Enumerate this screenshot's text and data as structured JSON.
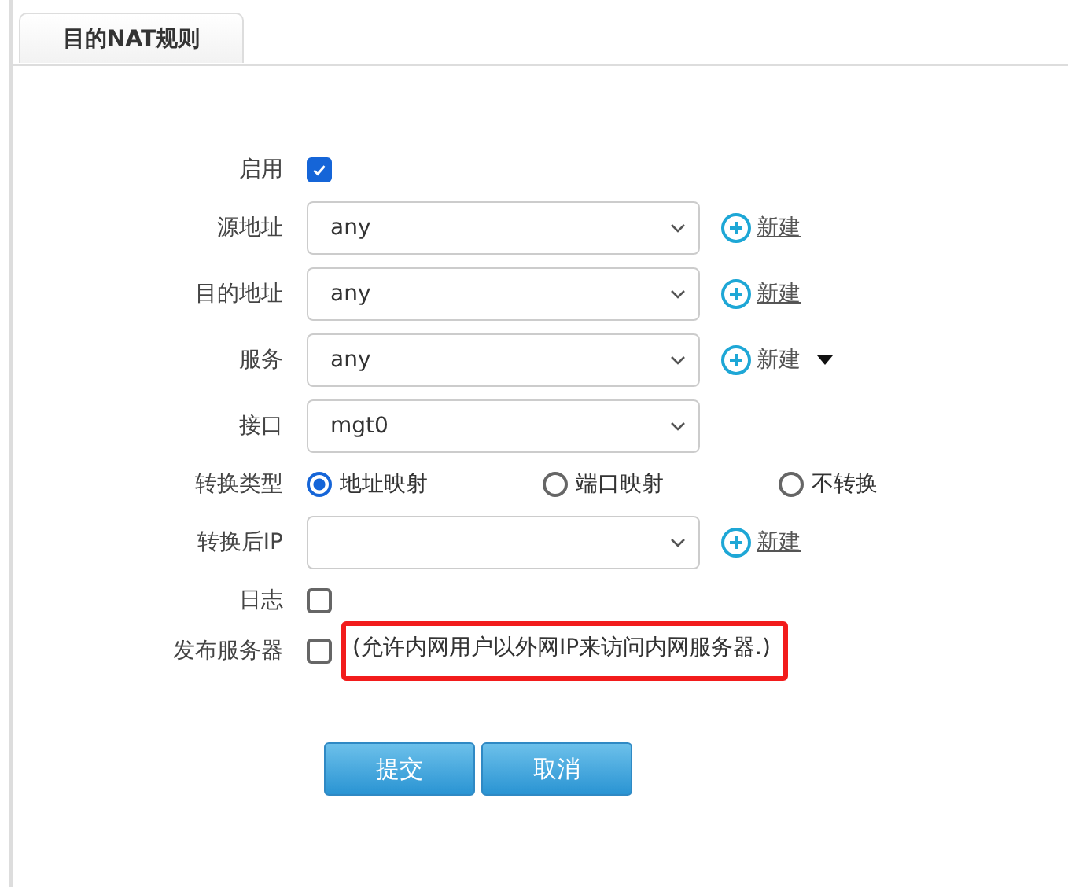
{
  "tabs": [
    {
      "label": "目的NAT规则",
      "selected": true
    }
  ],
  "form": [
    {
      "kind": "checkbox",
      "label": "启用",
      "checked": true
    },
    {
      "kind": "select",
      "label": "源地址",
      "value": "any",
      "new_link": {
        "label": "新建",
        "underlined": true,
        "dropdown": false
      }
    },
    {
      "kind": "select",
      "label": "目的地址",
      "value": "any",
      "new_link": {
        "label": "新建",
        "underlined": true,
        "dropdown": false
      }
    },
    {
      "kind": "select",
      "label": "服务",
      "value": "any",
      "new_link": {
        "label": "新建",
        "underlined": false,
        "dropdown": true
      }
    },
    {
      "kind": "select",
      "label": "接口",
      "value": "mgt0"
    },
    {
      "kind": "radio",
      "label": "转换类型",
      "options": [
        {
          "label": "地址映射",
          "selected": true
        },
        {
          "label": "端口映射",
          "selected": false
        },
        {
          "label": "不转换",
          "selected": false
        }
      ]
    },
    {
      "kind": "select",
      "label": "转换后IP",
      "new_link": {
        "label": "新建",
        "underlined": true,
        "dropdown": false
      }
    },
    {
      "kind": "checkbox",
      "label": "日志",
      "checked": false
    },
    {
      "kind": "checkbox",
      "label": "发布服务器",
      "checked": false,
      "note": "(允许内网用户以外网IP来访问内网服务器.)",
      "note_highlighted": true
    }
  ],
  "buttons": [
    "提交",
    "取消"
  ]
}
